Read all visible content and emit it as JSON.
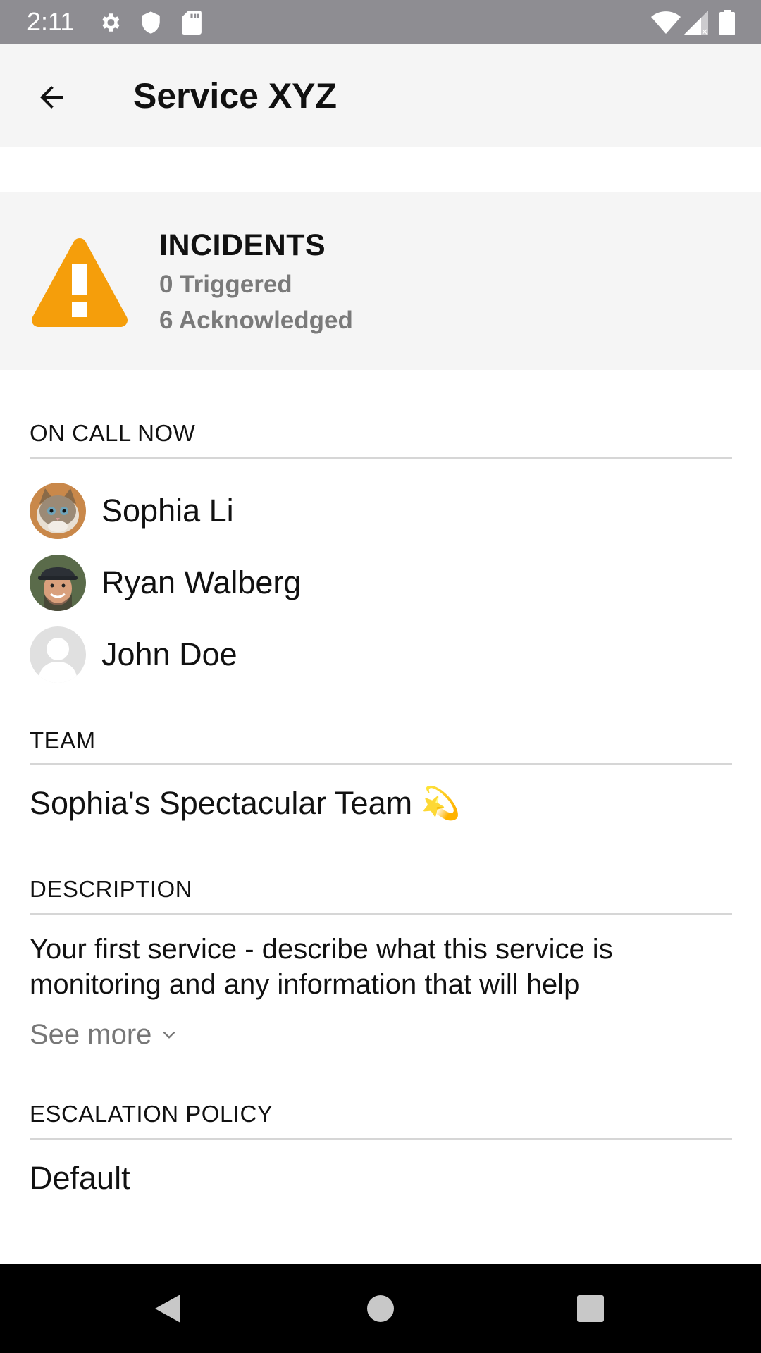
{
  "status_bar": {
    "time": "2:11",
    "icons": [
      "gear-icon",
      "shield-icon",
      "sd-card-icon",
      "wifi-icon",
      "signal-icon",
      "battery-icon"
    ]
  },
  "app_bar": {
    "title": "Service XYZ",
    "back_icon": "arrow-left-icon"
  },
  "incidents": {
    "heading": "INCIDENTS",
    "triggered": "0 Triggered",
    "acknowledged": "6 Acknowledged",
    "icon": "warning-triangle-icon",
    "icon_color": "#f59e0b"
  },
  "on_call": {
    "label": "ON CALL NOW",
    "people": [
      {
        "name": "Sophia Li"
      },
      {
        "name": "Ryan Walberg"
      },
      {
        "name": "John Doe"
      }
    ]
  },
  "team": {
    "label": "TEAM",
    "value": "Sophia's Spectacular Team 💫"
  },
  "description": {
    "label": "DESCRIPTION",
    "text": "Your first service - describe what this service is monitoring and any information that will help",
    "see_more": "See more"
  },
  "escalation_policy": {
    "label": "ESCALATION POLICY",
    "value": "Default"
  },
  "nav_bar": {
    "icons": [
      "back-triangle-icon",
      "home-circle-icon",
      "recents-square-icon"
    ]
  }
}
